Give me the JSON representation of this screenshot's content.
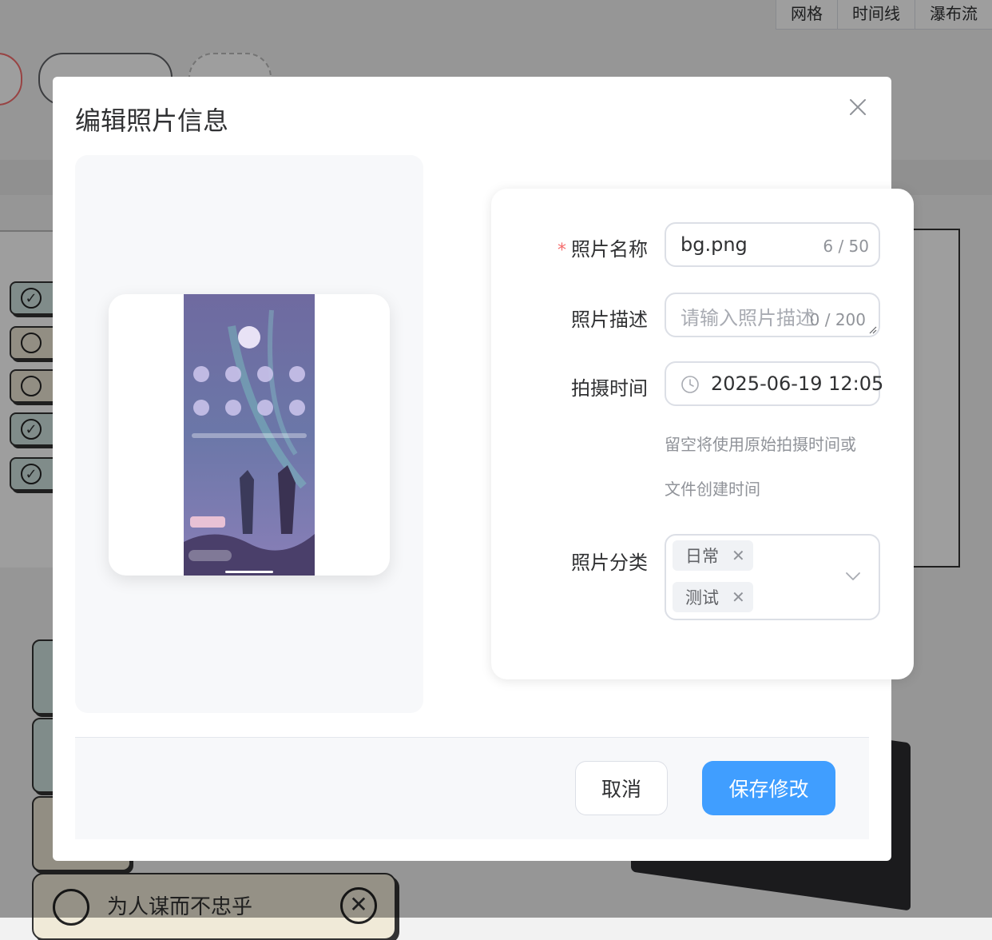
{
  "background": {
    "view_tabs": [
      "网格",
      "时间线",
      "瀑布流"
    ],
    "bottom_note_text": "为人谋而不忠乎"
  },
  "dialog": {
    "title": "编辑照片信息",
    "form": {
      "name": {
        "label": "照片名称",
        "required_mark": "*",
        "value": "bg.png",
        "counter": "6 / 50"
      },
      "description": {
        "label": "照片描述",
        "placeholder": "请输入照片描述",
        "counter": "0 / 200"
      },
      "taken_time": {
        "label": "拍摄时间",
        "value": "2025-06-19 12:05",
        "hint_line1": "留空将使用原始拍摄时间或",
        "hint_line2": "文件创建时间"
      },
      "category": {
        "label": "照片分类",
        "tags": [
          "日常",
          "测试"
        ]
      }
    },
    "footer": {
      "cancel_label": "取消",
      "save_label": "保存修改"
    }
  },
  "colors": {
    "primary": "#409eff",
    "required": "#f56c6c",
    "overlay": "rgba(0,0,0,0.38)"
  },
  "icons": [
    "close-icon",
    "clock-icon",
    "chevron-down-icon",
    "tag-close-icon"
  ]
}
